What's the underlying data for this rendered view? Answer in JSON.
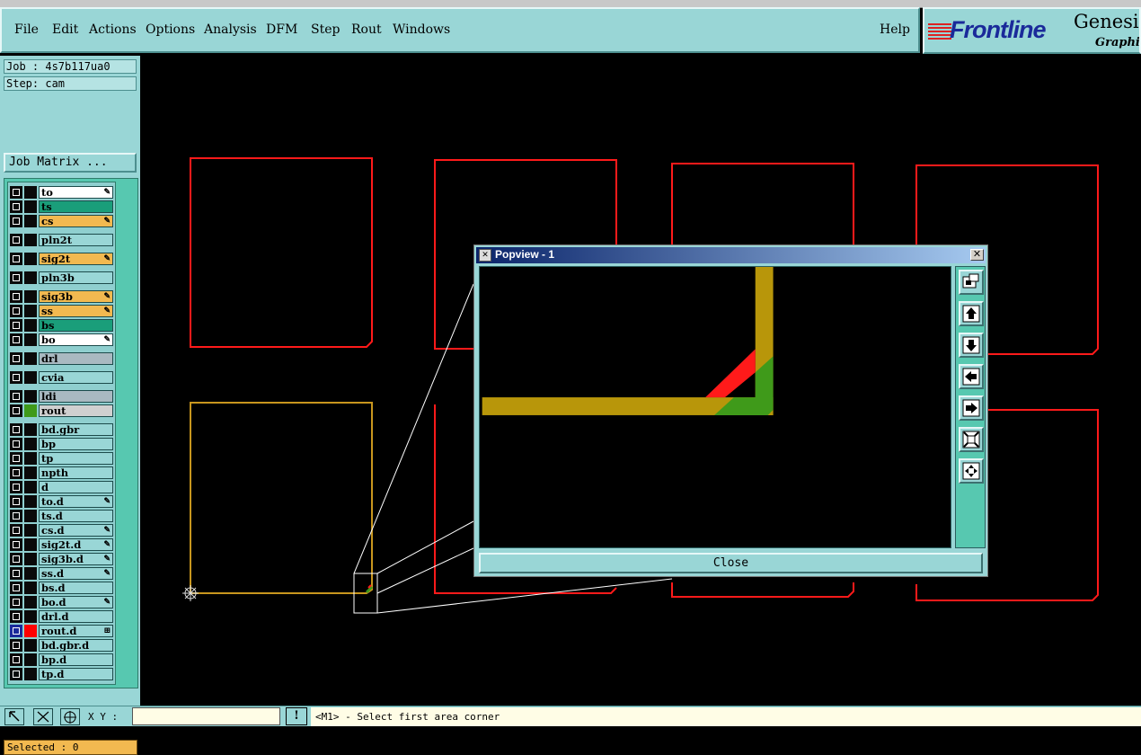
{
  "menubar": {
    "items": [
      {
        "label": "File"
      },
      {
        "label": "Edit"
      },
      {
        "label": "Actions"
      },
      {
        "label": "Options"
      },
      {
        "label": "Analysis"
      },
      {
        "label": "DFM"
      },
      {
        "label": "Step"
      },
      {
        "label": "Rout"
      },
      {
        "label": "Windows"
      }
    ],
    "help": "Help"
  },
  "brand": {
    "logo_text": "Frontline",
    "product": "Genesis",
    "subtitle": "Graphic"
  },
  "job": {
    "job_line": "Job : 4s7b117ua0",
    "step_line": "Step: cam",
    "matrix_button": "Job Matrix ..."
  },
  "layers": [
    {
      "name": "to",
      "bg": "#ffffff",
      "mark": "pen"
    },
    {
      "name": "ts",
      "bg": "#1a9e7a",
      "mark": ""
    },
    {
      "name": "cs",
      "bg": "#f2b950",
      "mark": "pen"
    },
    {
      "name": "pln2t",
      "bg": "#99d6d6",
      "mark": ""
    },
    {
      "name": "sig2t",
      "bg": "#f2b950",
      "mark": "pen"
    },
    {
      "name": "pln3b",
      "bg": "#99d6d6",
      "mark": ""
    },
    {
      "name": "sig3b",
      "bg": "#f2b950",
      "mark": "pen"
    },
    {
      "name": "ss",
      "bg": "#f2b950",
      "mark": "pen"
    },
    {
      "name": "bs",
      "bg": "#1a9e7a",
      "mark": ""
    },
    {
      "name": "bo",
      "bg": "#ffffff",
      "mark": "pen"
    },
    {
      "name": "drl",
      "bg": "#a9b9c1",
      "mark": ""
    },
    {
      "name": "cvia",
      "bg": "#99d6d6",
      "mark": ""
    },
    {
      "name": "ldi",
      "bg": "#a9b9c1",
      "mark": ""
    },
    {
      "name": "rout",
      "bg": "#d0d0d0",
      "mark": "",
      "color": "#3f9a1a"
    },
    {
      "name": "bd.gbr",
      "bg": "#99d6d6",
      "mark": ""
    },
    {
      "name": "bp",
      "bg": "#99d6d6",
      "mark": ""
    },
    {
      "name": "tp",
      "bg": "#99d6d6",
      "mark": ""
    },
    {
      "name": "npth",
      "bg": "#99d6d6",
      "mark": ""
    },
    {
      "name": "d",
      "bg": "#99d6d6",
      "mark": ""
    },
    {
      "name": "to.d",
      "bg": "#99d6d6",
      "mark": "pen"
    },
    {
      "name": "ts.d",
      "bg": "#99d6d6",
      "mark": ""
    },
    {
      "name": "cs.d",
      "bg": "#99d6d6",
      "mark": "pen"
    },
    {
      "name": "sig2t.d",
      "bg": "#99d6d6",
      "mark": "pen"
    },
    {
      "name": "sig3b.d",
      "bg": "#99d6d6",
      "mark": "pen"
    },
    {
      "name": "ss.d",
      "bg": "#99d6d6",
      "mark": "pen"
    },
    {
      "name": "bs.d",
      "bg": "#99d6d6",
      "mark": ""
    },
    {
      "name": "bo.d",
      "bg": "#99d6d6",
      "mark": "pen"
    },
    {
      "name": "drl.d",
      "bg": "#99d6d6",
      "mark": ""
    },
    {
      "name": "rout.d",
      "bg": "#99d6d6",
      "mark": "grid",
      "color": "#ff0000",
      "active": true
    },
    {
      "name": "bd.gbr.d",
      "bg": "#99d6d6",
      "mark": ""
    },
    {
      "name": "bp.d",
      "bg": "#99d6d6",
      "mark": ""
    },
    {
      "name": "tp.d",
      "bg": "#99d6d6",
      "mark": ""
    }
  ],
  "selected_text": "Selected : 0",
  "bottombar": {
    "xy_label": "X Y :",
    "xy_value": "",
    "bang_label": "!",
    "message": "<M1> - Select first area corner"
  },
  "popview": {
    "title": "Popview - 1",
    "close_x": "✕",
    "close_button": "Close",
    "tools": [
      "zoom-window-icon",
      "pan-up-icon",
      "pan-down-icon",
      "pan-left-icon",
      "pan-right-icon",
      "zoom-fit-icon",
      "zoom-home-icon"
    ]
  },
  "colors": {
    "panel": "#99d6d6",
    "board_outline": "#ff1a1a",
    "active_outline": "#c8961e",
    "rout_green": "#3f9a1a",
    "trace_gold": "#b8960a"
  }
}
